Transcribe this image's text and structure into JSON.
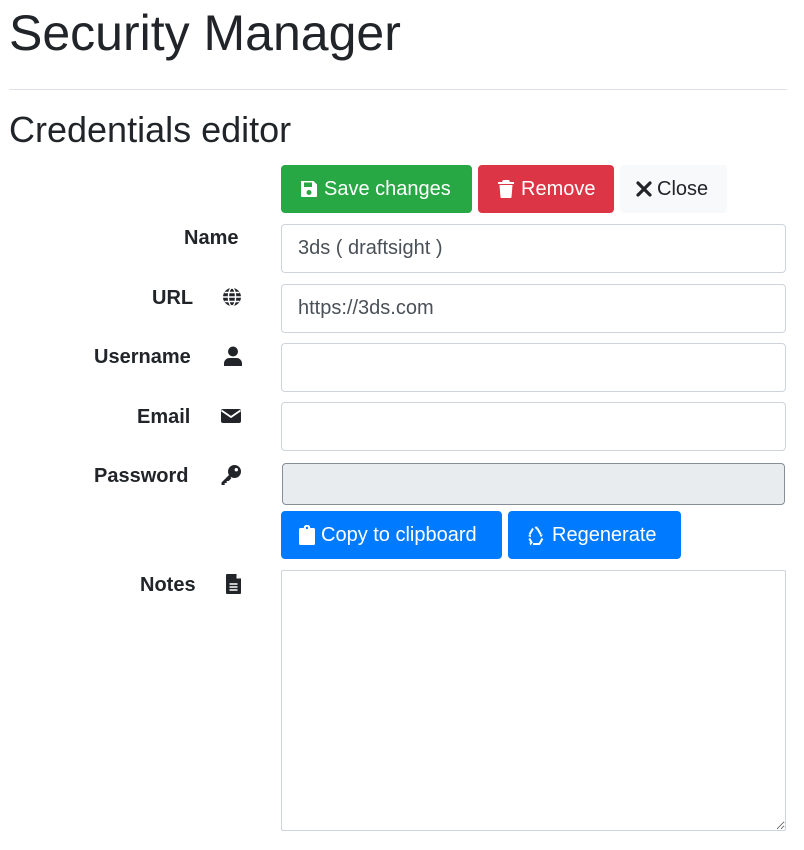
{
  "app": {
    "title": "Security Manager"
  },
  "editor": {
    "title": "Credentials editor"
  },
  "toolbar": {
    "save_label": "Save changes",
    "remove_label": "Remove",
    "close_label": "Close",
    "save_icon": "floppy-disk-icon",
    "remove_icon": "trash-icon",
    "close_icon": "x-icon"
  },
  "fields": {
    "name": {
      "label": "Name",
      "value": "3ds ( draftsight )"
    },
    "url": {
      "label": "URL",
      "value": "https://3ds.com",
      "icon": "globe-icon"
    },
    "username": {
      "label": "Username",
      "value": "",
      "icon": "user-icon"
    },
    "email": {
      "label": "Email",
      "value": "",
      "icon": "envelope-icon"
    },
    "password": {
      "label": "Password",
      "value": "",
      "icon": "key-icon"
    },
    "notes": {
      "label": "Notes",
      "value": "",
      "icon": "file-icon"
    }
  },
  "password_actions": {
    "copy_label": "Copy to clipboard",
    "regenerate_label": "Regenerate",
    "copy_icon": "clipboard-icon",
    "regenerate_icon": "recycle-icon"
  },
  "colors": {
    "success": "#28a745",
    "danger": "#dc3545",
    "primary": "#007bff",
    "light": "#f8f9fa"
  }
}
